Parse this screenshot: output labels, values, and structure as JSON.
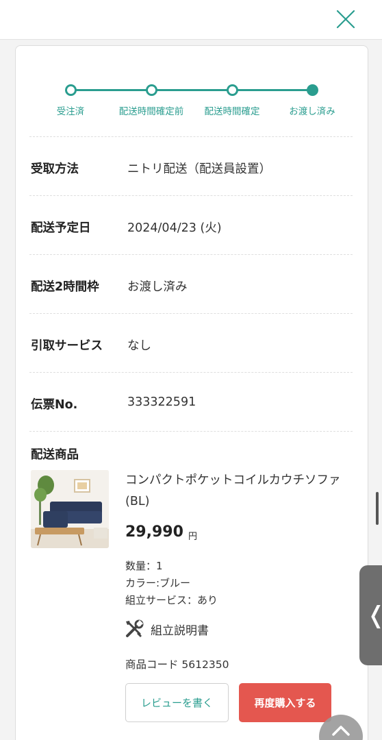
{
  "stepper": {
    "steps": [
      {
        "label": "受注済",
        "done": false
      },
      {
        "label": "配送時間確定前",
        "done": false
      },
      {
        "label": "配送時間確定",
        "done": false
      },
      {
        "label": "お渡し済み",
        "done": true
      }
    ]
  },
  "details": [
    {
      "label": "受取方法",
      "value": "ニトリ配送（配送員設置）"
    },
    {
      "label": "配送予定日",
      "value": "2024/04/23 (火)"
    },
    {
      "label": "配送2時間枠",
      "value": "お渡し済み"
    },
    {
      "label": "引取サービス",
      "value": "なし"
    },
    {
      "label": "伝票No.",
      "value": "333322591"
    }
  ],
  "products": {
    "title": "配送商品",
    "item": {
      "name": "コンパクトポケットコイルカウチソファ (BL)",
      "price": "29,990",
      "price_unit": "円",
      "quantity": "数量：1",
      "color": "カラー:ブルー",
      "assembly": "組立サービス：あり",
      "manual_label": "組立説明書",
      "product_code": "商品コード 5612350",
      "review_button": "レビューを書く",
      "rebuy_button": "再度購入する"
    }
  },
  "side_tab": {
    "chevron": "❬"
  },
  "colors": {
    "accent": "#2a9d8f",
    "rebuy": "#e4574f",
    "side_tab": "#6e6e6e"
  },
  "icons": {
    "close": "close-icon",
    "manual": "tools-icon",
    "scroll_top": "chevron-up-icon"
  }
}
